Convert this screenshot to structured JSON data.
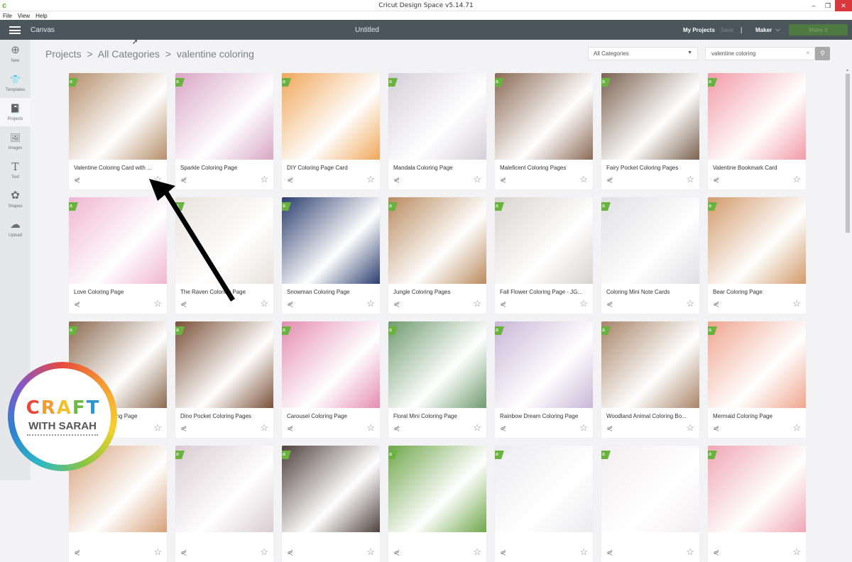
{
  "window": {
    "title": "Cricut Design Space  v5.14.71",
    "app_icon": "cricut-c-logo",
    "controls": [
      "minimize",
      "restore",
      "close"
    ]
  },
  "menubar": {
    "items": [
      "File",
      "View",
      "Help"
    ]
  },
  "header": {
    "menu_icon": "hamburger-icon",
    "section": "Canvas",
    "document_title": "Untitled",
    "my_projects": "My Projects",
    "save": "Save",
    "separator": "|",
    "machine": "Maker",
    "make_it": "Make It"
  },
  "sidebar": {
    "items": [
      {
        "label": "New",
        "icon": "plus-circle-icon",
        "glyph": "⊕"
      },
      {
        "label": "Templates",
        "icon": "tshirt-icon",
        "glyph": "👕"
      },
      {
        "label": "Projects",
        "icon": "notebook-icon",
        "glyph": "📓",
        "active": true
      },
      {
        "label": "Images",
        "icon": "image-icon",
        "glyph": "🖼"
      },
      {
        "label": "Text",
        "icon": "text-icon",
        "glyph": "T"
      },
      {
        "label": "Shapes",
        "icon": "shapes-icon",
        "glyph": "✿"
      },
      {
        "label": "Upload",
        "icon": "cloud-upload-icon",
        "glyph": "☁"
      }
    ]
  },
  "breadcrumb": {
    "items": [
      "Projects",
      ">",
      "All Categories",
      ">",
      "valentine coloring"
    ]
  },
  "filters": {
    "category": "All Categories",
    "search_value": "valentine coloring",
    "search_icon": "magnifier-icon",
    "clear_icon": "x-icon"
  },
  "projects": [
    {
      "name": "Valentine Coloring Card with ...",
      "color": "#b58e6a"
    },
    {
      "name": "Sparkle Coloring Page",
      "color": "#d9a6c6"
    },
    {
      "name": "DIY Coloring Page Card",
      "color": "#f0a75a"
    },
    {
      "name": "Mandala Coloring Page",
      "color": "#d4cfd8"
    },
    {
      "name": "Maleficent Coloring Pages",
      "color": "#8c6a55"
    },
    {
      "name": "Fairy Pocket Coloring Pages",
      "color": "#7a6250"
    },
    {
      "name": "Valentine Bookmark Card",
      "color": "#f29ba6"
    },
    {
      "name": "Love Coloring Page",
      "color": "#f0b6d0"
    },
    {
      "name": "The Raven Coloring Page",
      "color": "#e8e2dc"
    },
    {
      "name": "Snowman Coloring Page",
      "color": "#2b3d6e"
    },
    {
      "name": "Jungle Coloring Pages",
      "color": "#b98a5e"
    },
    {
      "name": "Fall Flower Coloring Page - JG...",
      "color": "#d8d3cf"
    },
    {
      "name": "Coloring Mini Note Cards",
      "color": "#e0dfe2"
    },
    {
      "name": "Bear Coloring Page",
      "color": "#d29a6a"
    },
    {
      "name": "Adventure Coloring Page",
      "color": "#8b6a4f"
    },
    {
      "name": "Dino Pocket Coloring Pages",
      "color": "#7a5038"
    },
    {
      "name": "Carousel Coloring Page",
      "color": "#e58db0"
    },
    {
      "name": "Floral Mini Coloring Page",
      "color": "#6f9b6e"
    },
    {
      "name": "Rainbow Dream Coloring Page",
      "color": "#c8b6d6"
    },
    {
      "name": "Woodland Animal Coloring Bo...",
      "color": "#a88468"
    },
    {
      "name": "Mermaid Coloring Page",
      "color": "#f0a58e"
    },
    {
      "name": "",
      "color": "#d7a07a"
    },
    {
      "name": "",
      "color": "#d9ccd0"
    },
    {
      "name": "",
      "color": "#4f413d"
    },
    {
      "name": "",
      "color": "#6fa64b"
    },
    {
      "name": "",
      "color": "#ecebee"
    },
    {
      "name": "",
      "color": "#f3eef0"
    },
    {
      "name": "",
      "color": "#f0a7b3"
    }
  ],
  "card_icons": {
    "share": "share-icon",
    "favorite": "star-outline-icon",
    "badge": "cricut-access-badge-icon"
  },
  "overlay": {
    "logo_line1": [
      "C",
      "R",
      "A",
      "F",
      "T"
    ],
    "logo_colors": [
      "#e8473a",
      "#f39c34",
      "#f0c12d",
      "#6cba45",
      "#2e95d3"
    ],
    "logo_line2": "WITH SARAH"
  }
}
